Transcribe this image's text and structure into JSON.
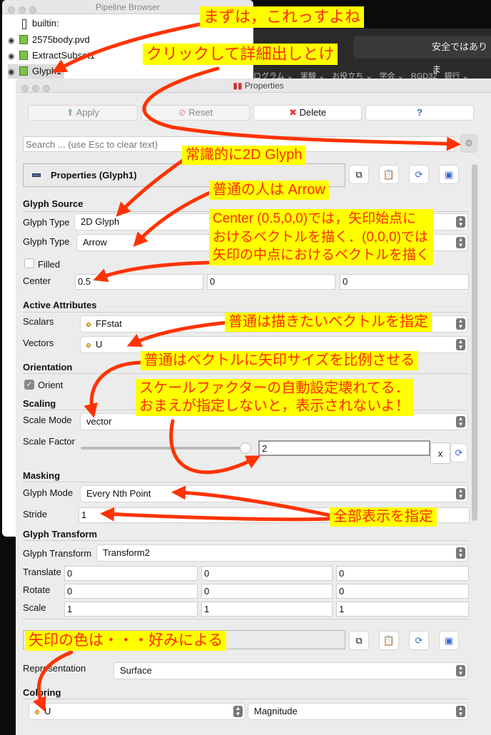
{
  "pipeline_browser": {
    "title": "Pipeline Browser",
    "items": [
      "builtin:",
      "2575body.pvd",
      "ExtractSubset1",
      "Glyph1"
    ]
  },
  "background_browser": {
    "address": "安全ではありま",
    "bookmarks": [
      "ログラム ⌄",
      "実験 ⌄",
      "お役立ち ⌄",
      "学会 ⌄",
      "RGD32",
      "銀行 ⌄"
    ]
  },
  "properties": {
    "title": "Properties",
    "buttons": {
      "apply": "Apply",
      "reset": "Reset",
      "delete": "Delete",
      "help": "?"
    },
    "search_placeholder": "Search ... (use Esc to clear text)",
    "header": "Properties (Glyph1)",
    "glyph_source": {
      "section": "Glyph Source",
      "glyph_type_label": "Glyph Type",
      "glyph_type": "2D Glyph",
      "glyph_type2_label": "Glyph Type",
      "glyph_type2": "Arrow",
      "filled_label": "Filled",
      "filled": false,
      "center_label": "Center",
      "center": [
        "0.5",
        "0",
        "0"
      ]
    },
    "active_attributes": {
      "section": "Active Attributes",
      "scalars_label": "Scalars",
      "scalars": "FFstat",
      "vectors_label": "Vectors",
      "vectors": "U"
    },
    "orientation": {
      "section": "Orientation",
      "orient_label": "Orient",
      "orient": true
    },
    "scaling": {
      "section": "Scaling",
      "scale_mode_label": "Scale Mode",
      "scale_mode": "vector",
      "scale_factor_label": "Scale Factor",
      "scale_factor": "2",
      "clear": "x"
    },
    "masking": {
      "section": "Masking",
      "glyph_mode_label": "Glyph Mode",
      "glyph_mode": "Every Nth Point",
      "stride_label": "Stride",
      "stride": "1"
    },
    "glyph_transform": {
      "section": "Glyph Transform",
      "label": "Glyph Transform",
      "value": "Transform2",
      "translate_label": "Translate",
      "translate": [
        "0",
        "0",
        "0"
      ],
      "rotate_label": "Rotate",
      "rotate": [
        "0",
        "0",
        "0"
      ],
      "scale_label": "Scale",
      "scale": [
        "1",
        "1",
        "1"
      ]
    },
    "display": {
      "representation_label": "Representation",
      "representation": "Surface",
      "coloring_label": "Coloring",
      "color_by": "U",
      "color_component": "Magnitude"
    }
  },
  "annotations": [
    "まずは，これっすよね",
    "クリックして詳細出しとけ",
    "常識的に2D Glyph",
    "普通の人は Arrow",
    "Center (0.5,0,0)では，矢印始点に\nおけるベクトルを描く．(0,0,0)では\n矢印の中点におけるベクトルを描く",
    "普通は描きたいベクトルを指定",
    "普通はベクトルに矢印サイズを比例させる",
    "スケールファクターの自動設定壊れてる．\nおまえが指定しないと，表示されないよ！",
    "全部表示を指定",
    "矢印の色は・・・好みによる"
  ],
  "colors": {
    "annotation_text": "#ff2a00",
    "annotation_bg": "#ffff00",
    "arrow": "#ff3300"
  }
}
